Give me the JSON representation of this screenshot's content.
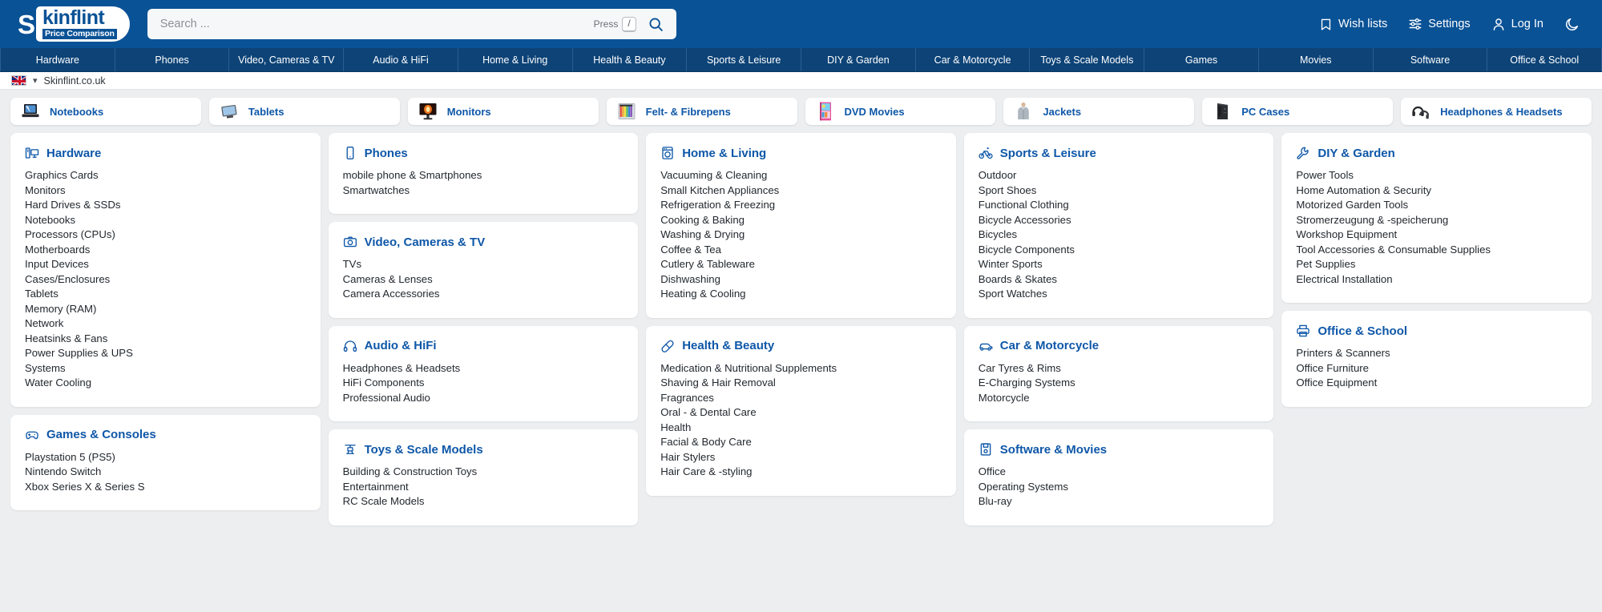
{
  "brand": {
    "logo_initial": "S",
    "logo_main": "kinflint",
    "logo_sub": "Price Comparison",
    "accent": "#0a5296",
    "link_blue": "#0e57a8"
  },
  "search": {
    "placeholder": "Search ...",
    "value": "",
    "press_label": "Press",
    "key": "/",
    "go_icon": "search-icon"
  },
  "header_actions": [
    {
      "label": "Wish lists",
      "icon": "bookmark-icon"
    },
    {
      "label": "Settings",
      "icon": "sliders-icon"
    },
    {
      "label": "Log In",
      "icon": "user-icon"
    },
    {
      "label": "",
      "icon": "moon-icon"
    }
  ],
  "nav": [
    "Hardware",
    "Phones",
    "Video, Cameras & TV",
    "Audio & HiFi",
    "Home & Living",
    "Health & Beauty",
    "Sports & Leisure",
    "DIY & Garden",
    "Car & Motorcycle",
    "Toys & Scale Models",
    "Games",
    "Movies",
    "Software",
    "Office & School"
  ],
  "locale": {
    "flag": "uk-flag-icon",
    "caret": "chevron-down-icon",
    "site": "Skinflint.co.uk"
  },
  "quicklinks": [
    {
      "label": "Notebooks",
      "thumb": "notebook-thumb"
    },
    {
      "label": "Tablets",
      "thumb": "tablet-thumb"
    },
    {
      "label": "Monitors",
      "thumb": "monitor-thumb"
    },
    {
      "label": "Felt- & Fibrepens",
      "thumb": "pens-thumb"
    },
    {
      "label": "DVD Movies",
      "thumb": "dvd-thumb"
    },
    {
      "label": "Jackets",
      "thumb": "jacket-thumb"
    },
    {
      "label": "PC Cases",
      "thumb": "pccase-thumb"
    },
    {
      "label": "Headphones & Headsets",
      "thumb": "headphones-thumb"
    }
  ],
  "columns": [
    {
      "cards": [
        {
          "title": "Hardware",
          "icon": "desktop-monitor-icon",
          "items": [
            "Graphics Cards",
            "Monitors",
            "Hard Drives & SSDs",
            "Notebooks",
            "Processors (CPUs)",
            "Motherboards",
            "Input Devices",
            "Cases/Enclosures",
            "Tablets",
            "Memory (RAM)",
            "Network",
            "Heatsinks & Fans",
            "Power Supplies & UPS",
            "Systems",
            "Water Cooling"
          ]
        },
        {
          "title": "Games & Consoles",
          "icon": "gamepad-icon",
          "items": [
            "Playstation 5 (PS5)",
            "Nintendo Switch",
            "Xbox Series X & Series S"
          ]
        }
      ]
    },
    {
      "cards": [
        {
          "title": "Phones",
          "icon": "smartphone-icon",
          "items": [
            "mobile phone & Smartphones",
            "Smartwatches"
          ]
        },
        {
          "title": "Video, Cameras & TV",
          "icon": "camera-icon",
          "items": [
            "TVs",
            "Cameras & Lenses",
            "Camera Accessories"
          ]
        },
        {
          "title": "Audio & HiFi",
          "icon": "headphones-icon",
          "items": [
            "Headphones & Headsets",
            "HiFi Components",
            "Professional Audio"
          ]
        },
        {
          "title": "Toys & Scale Models",
          "icon": "drone-icon",
          "items": [
            "Building & Construction Toys",
            "Entertainment",
            "RC Scale Models"
          ]
        }
      ]
    },
    {
      "cards": [
        {
          "title": "Home & Living",
          "icon": "washing-machine-icon",
          "items": [
            "Vacuuming & Cleaning",
            "Small Kitchen Appliances",
            "Refrigeration & Freezing",
            "Cooking & Baking",
            "Washing & Drying",
            "Coffee & Tea",
            "Cutlery & Tableware",
            "Dishwashing",
            "Heating & Cooling"
          ]
        },
        {
          "title": "Health & Beauty",
          "icon": "pill-icon",
          "items": [
            "Medication & Nutritional Supplements",
            "Shaving & Hair Removal",
            "Fragrances",
            "Oral - & Dental Care",
            "Health",
            "Facial & Body Care",
            "Hair Stylers",
            "Hair Care & -styling"
          ]
        }
      ]
    },
    {
      "cards": [
        {
          "title": "Sports & Leisure",
          "icon": "bicycle-icon",
          "items": [
            "Outdoor",
            "Sport Shoes",
            "Functional Clothing",
            "Bicycle Accessories",
            "Bicycles",
            "Bicycle Components",
            "Winter Sports",
            "Boards & Skates",
            "Sport Watches"
          ]
        },
        {
          "title": "Car & Motorcycle",
          "icon": "car-icon",
          "items": [
            "Car Tyres & Rims",
            "E-Charging Systems",
            "Motorcycle"
          ]
        },
        {
          "title": "Software & Movies",
          "icon": "floppy-disk-icon",
          "items": [
            "Office",
            "Operating Systems",
            "Blu-ray"
          ]
        }
      ]
    },
    {
      "cards": [
        {
          "title": "DIY & Garden",
          "icon": "wrench-icon",
          "items": [
            "Power Tools",
            "Home Automation & Security",
            "Motorized Garden Tools",
            "Stromerzeugung & -speicherung",
            "Workshop Equipment",
            "Tool Accessories & Consumable Supplies",
            "Pet Supplies",
            "Electrical Installation"
          ]
        },
        {
          "title": "Office & School",
          "icon": "printer-icon",
          "items": [
            "Printers & Scanners",
            "Office Furniture",
            "Office Equipment"
          ]
        }
      ]
    }
  ]
}
